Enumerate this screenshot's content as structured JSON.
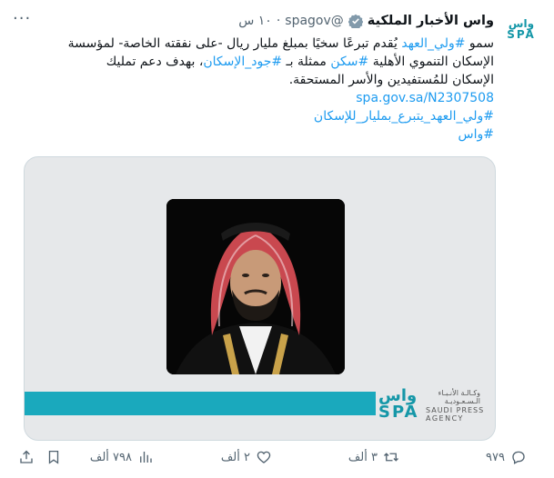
{
  "account": {
    "avatar_line1": "واس",
    "avatar_line2": "SPA",
    "name": "واس الأخبار الملكية",
    "handle": "@spagov",
    "separator": "·",
    "time": "١٠ س"
  },
  "tweet": {
    "lines": [
      {
        "segments": [
          {
            "t": "سمو ",
            "link": false
          },
          {
            "t": "#ولي_العهد",
            "link": true
          },
          {
            "t": " يُقدم تبرعًا سخيًا بمبلغ مليار ريال -على نفقته الخاصة- لمؤسسة",
            "link": false
          }
        ]
      },
      {
        "segments": [
          {
            "t": "الإسكان التنموي الأهلية ",
            "link": false
          },
          {
            "t": "#سكن",
            "link": true
          },
          {
            "t": " ممثلة بـ ",
            "link": false
          },
          {
            "t": "#جود_الإسكان",
            "link": true
          },
          {
            "t": "، بهدف دعم تمليك",
            "link": false
          }
        ]
      },
      {
        "segments": [
          {
            "t": "الإسكان للمُستفيدين والأسر المستحقة.",
            "link": false
          }
        ]
      },
      {
        "segments": [
          {
            "t": "spa.gov.sa/N2307508",
            "link": true
          }
        ]
      },
      {
        "segments": [
          {
            "t": "#ولي_العهد_يتبرع_بمليار_للإسكان",
            "link": true
          }
        ]
      },
      {
        "segments": [
          {
            "t": "#واس",
            "link": true
          }
        ]
      }
    ]
  },
  "media": {
    "logo_spa_line1": "واس",
    "logo_spa_line2": "SPA",
    "logo_ar_line1": "وكـالـة الأنـبـاء",
    "logo_ar_line2": "الـسـعـوديـة",
    "logo_en_line1": "SAUDI PRESS",
    "logo_en_line2": "AGENCY"
  },
  "actions": {
    "replies": "٩٧٩",
    "reposts": "٣ ألف",
    "likes": "٢ ألف",
    "views": "٧٩٨ ألف"
  },
  "colors": {
    "link": "#1d9bf0",
    "brand_teal": "#1aa9bd",
    "verified": "#829aab",
    "muted": "#536471"
  }
}
